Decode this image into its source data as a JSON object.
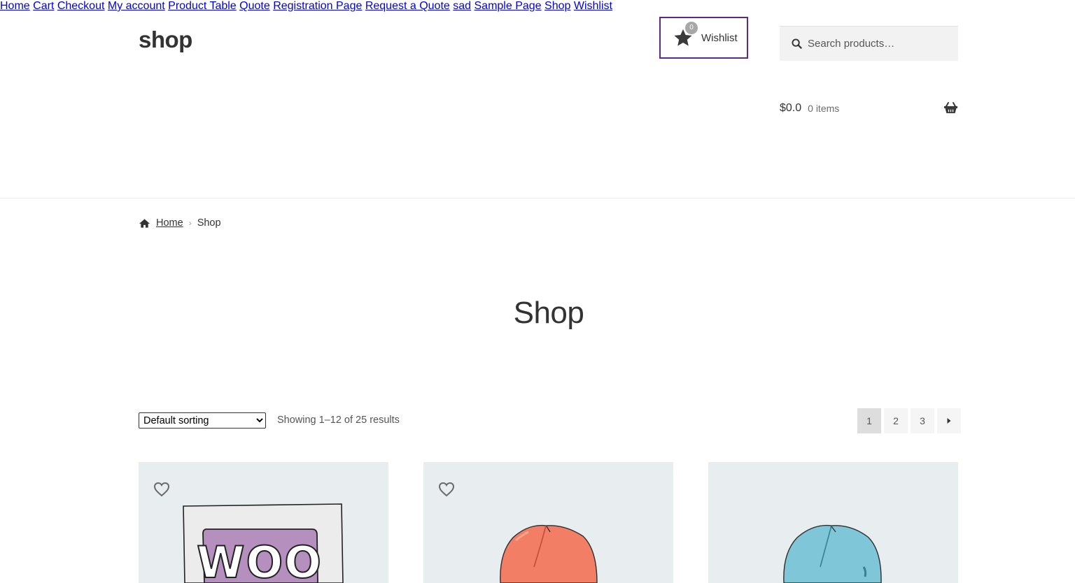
{
  "site": {
    "title": "shop"
  },
  "wishlist": {
    "count": "0",
    "label": "Wishlist"
  },
  "search": {
    "placeholder": "Search products…"
  },
  "nav": {
    "items": [
      {
        "label": "Home"
      },
      {
        "label": "Cart"
      },
      {
        "label": "Checkout"
      },
      {
        "label": "My account"
      },
      {
        "label": "Product Table"
      },
      {
        "label": "Quote"
      },
      {
        "label": "Registration Page"
      },
      {
        "label": "Request a Quote"
      },
      {
        "label": "sad"
      },
      {
        "label": "Sample Page"
      },
      {
        "label": "Shop"
      },
      {
        "label": "Wishlist"
      }
    ]
  },
  "cart": {
    "amount": "$0.0",
    "items": "0 items"
  },
  "breadcrumb": {
    "home": "Home",
    "current": "Shop"
  },
  "page": {
    "title": "Shop"
  },
  "toolbar": {
    "sort_selected": "Default sorting",
    "result_count": "Showing 1–12 of 25 results"
  },
  "pagination": {
    "pages": [
      "1",
      "2",
      "3"
    ],
    "current": "1",
    "next_icon": "arrow-right-icon"
  },
  "products": [
    {
      "name": "woo-album-image"
    },
    {
      "name": "orange-beanie-image"
    },
    {
      "name": "blue-beanie-image"
    }
  ],
  "colors": {
    "accent": "#5b2a86",
    "card_bg": "#e8edf0"
  }
}
